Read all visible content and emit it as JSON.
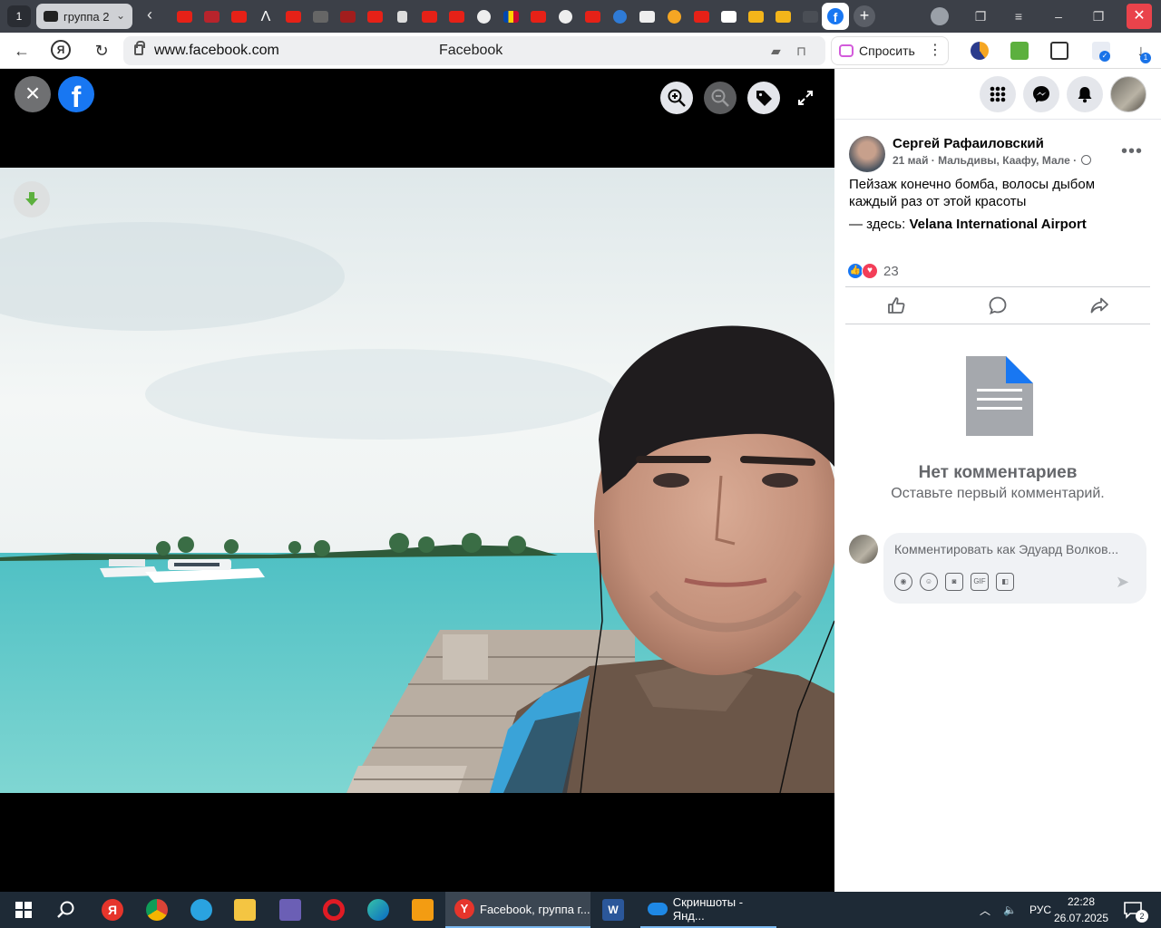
{
  "browser": {
    "tab_count": "1",
    "group_tab_label": "группа 2",
    "url": "www.facebook.com",
    "page_title": "Facebook",
    "ask_button_label": "Спросить",
    "download_badge": "1"
  },
  "viewer": {
    "zoom_in_icon": "zoom-in-icon",
    "zoom_out_icon": "zoom-out-icon",
    "tag_icon": "tag-icon"
  },
  "post": {
    "author": "Сергей Рафаиловский",
    "meta": "21 май · Мальдивы, Каафу, Мале ·",
    "text": "Пейзаж конечно бомба, волосы дыбом каждый раз от этой красоты",
    "location_prefix": "— здесь: ",
    "location_name": "Velana International Airport",
    "reaction_count": "23"
  },
  "comments": {
    "empty_title": "Нет комментариев",
    "empty_subtitle": "Оставьте первый комментарий.",
    "placeholder": "Комментировать как Эдуард Волков..."
  },
  "taskbar": {
    "active_task": "Facebook, группа г...",
    "task2": "Скриншоты - Янд...",
    "language": "РУС",
    "time": "22:28",
    "date": "26.07.2025",
    "notifications": "2"
  },
  "colors": {
    "facebook_blue": "#1877f2",
    "love_red": "#f33e58",
    "tab_strip": "#3c4048",
    "taskbar": "#1e2a36"
  }
}
